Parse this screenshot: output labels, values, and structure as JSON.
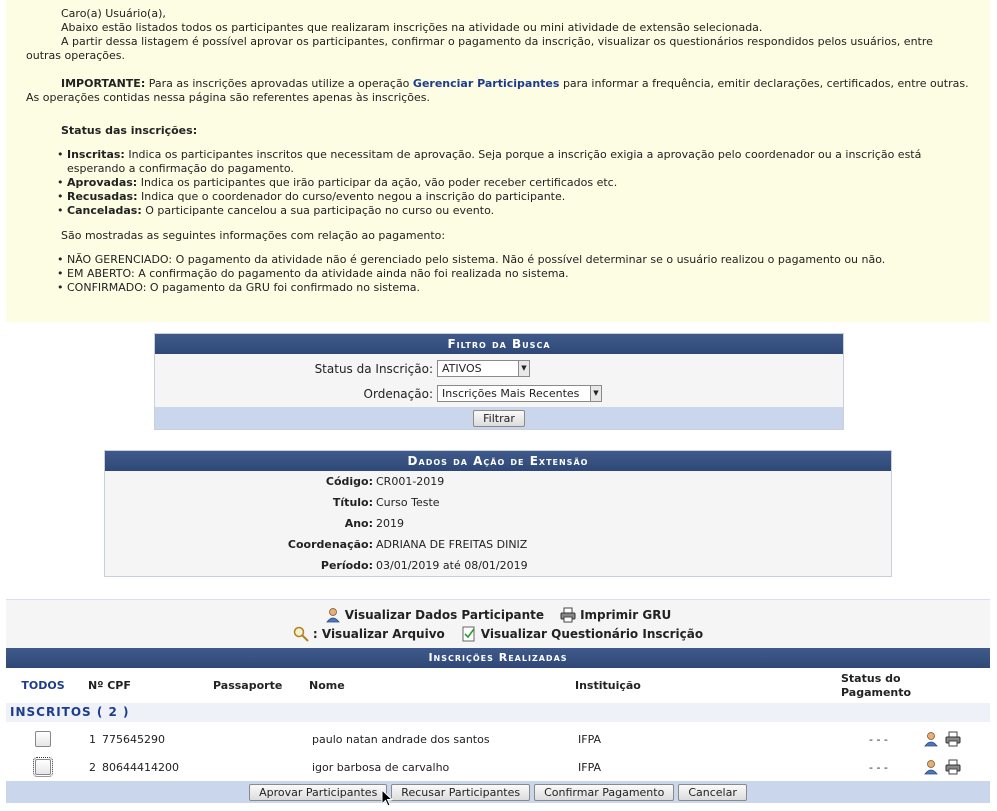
{
  "info": {
    "greeting": "Caro(a) Usuário(a),",
    "p1": "Abaixo estão listados todos os participantes que realizaram inscrições na atividade ou mini atividade de extensão selecionada.",
    "p2": "A partir dessa listagem é possível aprovar os participantes, confirmar o pagamento da inscrição, visualizar os questionários respondidos pelos usuários, entre outras operações.",
    "important_label": "IMPORTANTE:",
    "important_pre": "Para as inscrições aprovadas utilize a operação",
    "important_link": "Gerenciar Participantes",
    "important_post": "para informar a frequência, emitir declarações, certificados, entre outras. As operações contidas nessa página são referentes apenas às inscrições.",
    "status_title": "Status das inscrições:",
    "status_items": [
      {
        "label": "Inscritas:",
        "text": "Indica os participantes inscritos que necessitam de aprovação. Seja porque a inscrição exigia a aprovação pelo coordenador ou a inscrição está esperando a confirmação do pagamento."
      },
      {
        "label": "Aprovadas:",
        "text": "Indica os participantes que irão participar da ação, vão poder receber certificados etc."
      },
      {
        "label": "Recusadas:",
        "text": "Indica que o coordenador do curso/evento negou a inscrição do participante."
      },
      {
        "label": "Canceladas:",
        "text": "O participante cancelou a sua participação no curso ou evento."
      }
    ],
    "payment_intro": "São mostradas as seguintes informações com relação ao pagamento:",
    "payment_items": [
      "NÃO GERENCIADO: O pagamento da atividade não é gerenciado pelo sistema. Não é possível determinar se o usuário realizou o pagamento ou não.",
      "EM ABERTO: A confirmação do pagamento da atividade ainda não foi realizada no sistema.",
      "CONFIRMADO: O pagamento da GRU foi confirmado no sistema."
    ]
  },
  "filter": {
    "title": "Filtro da Busca",
    "status_label": "Status da Inscrição:",
    "status_value": "ATIVOS",
    "order_label": "Ordenação:",
    "order_value": "Inscrições Mais Recentes",
    "button": "Filtrar"
  },
  "dados": {
    "title": "Dados da Ação de Extensão",
    "fields": [
      {
        "label": "Código:",
        "value": "CR001-2019"
      },
      {
        "label": "Título:",
        "value": "Curso Teste"
      },
      {
        "label": "Ano:",
        "value": "2019"
      },
      {
        "label": "Coordenação:",
        "value": "ADRIANA DE FREITAS DINIZ"
      },
      {
        "label": "Período:",
        "value": "03/01/2019 até 08/01/2019"
      }
    ]
  },
  "legend": {
    "participante": "Visualizar Dados Participante",
    "gru": "Imprimir GRU",
    "arquivo": ": Visualizar Arquivo",
    "questionario": "Visualizar Questionário Inscrição"
  },
  "inscricoes": {
    "title": "Inscrições Realizadas",
    "columns": {
      "todos": "TODOS",
      "cpf": "Nº CPF",
      "passaporte": "Passaporte",
      "nome": "Nome",
      "instituicao": "Instituição",
      "status_l1": "Status do",
      "status_l2": "Pagamento"
    },
    "group": "INSCRITOS ( 2 )",
    "rows": [
      {
        "n": "1",
        "cpf": "775645290",
        "passaporte": "",
        "nome": "paulo natan andrade dos santos",
        "instituicao": "IFPA",
        "status": "- - -"
      },
      {
        "n": "2",
        "cpf": "80644414200",
        "passaporte": "",
        "nome": "igor barbosa de carvalho",
        "instituicao": "IFPA",
        "status": "- - -"
      }
    ],
    "buttons": {
      "aprovar": "Aprovar Participantes",
      "recusar": "Recusar Participantes",
      "confirmar": "Confirmar Pagamento",
      "cancelar": "Cancelar"
    }
  },
  "colors": {
    "info_bg": "#fdfde3",
    "header_bg": "#2f4878",
    "footer_bg": "#c9d6ec",
    "link": "#1d3d8c"
  }
}
